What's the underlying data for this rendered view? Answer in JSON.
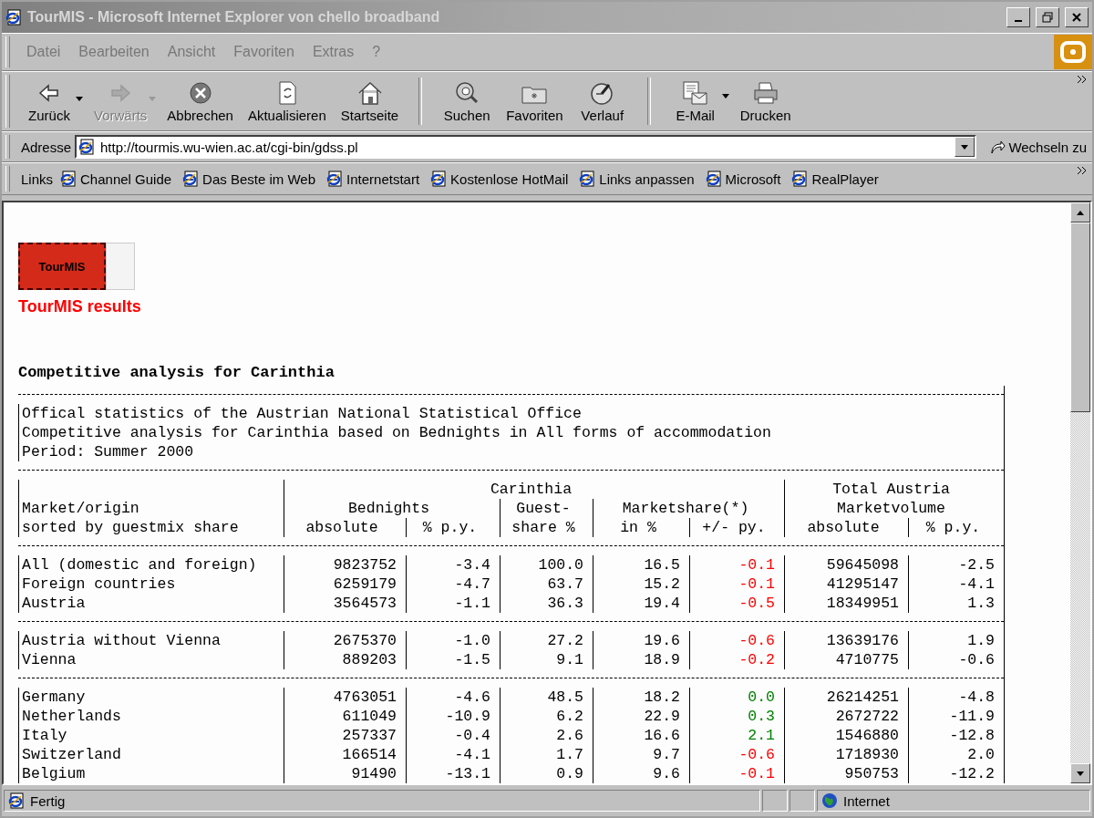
{
  "window": {
    "title": "TourMIS - Microsoft Internet Explorer von chello broadband"
  },
  "menu": [
    "Datei",
    "Bearbeiten",
    "Ansicht",
    "Favoriten",
    "Extras",
    "?"
  ],
  "toolbar": [
    {
      "label": "Zurück",
      "kind": "back",
      "disabled": false,
      "dropdown": true,
      "separator_before": false
    },
    {
      "label": "Vorwärts",
      "kind": "forward",
      "disabled": true,
      "dropdown": true,
      "separator_before": false
    },
    {
      "label": "Abbrechen",
      "kind": "stop",
      "disabled": false,
      "dropdown": false,
      "separator_before": false
    },
    {
      "label": "Aktualisieren",
      "kind": "refresh",
      "disabled": false,
      "dropdown": false,
      "separator_before": false
    },
    {
      "label": "Startseite",
      "kind": "home",
      "disabled": false,
      "dropdown": false,
      "separator_before": false
    },
    {
      "label": "Suchen",
      "kind": "search",
      "disabled": false,
      "dropdown": false,
      "separator_before": true
    },
    {
      "label": "Favoriten",
      "kind": "favorites",
      "disabled": false,
      "dropdown": false,
      "separator_before": false
    },
    {
      "label": "Verlauf",
      "kind": "history",
      "disabled": false,
      "dropdown": false,
      "separator_before": false
    },
    {
      "label": "E-Mail",
      "kind": "mail",
      "disabled": false,
      "dropdown": true,
      "separator_before": true
    },
    {
      "label": "Drucken",
      "kind": "print",
      "disabled": false,
      "dropdown": false,
      "separator_before": false
    }
  ],
  "address": {
    "label": "Adresse",
    "url": "http://tourmis.wu-wien.ac.at/cgi-bin/gdss.pl",
    "go": "Wechseln zu"
  },
  "links": {
    "label": "Links",
    "items": [
      "Channel Guide",
      "Das Beste im Web",
      "Internetstart",
      "Kostenlose HotMail",
      "Links anpassen",
      "Microsoft",
      "RealPlayer"
    ]
  },
  "page": {
    "logo_text": "TourMIS",
    "results_heading": "TourMIS results",
    "title": "Competitive analysis for Carinthia",
    "notes": [
      "Offical statistics of the Austrian National Statistical Office",
      "Competitive analysis for Carinthia based on Bednights in All forms of accommodation",
      "Period: Summer 2000"
    ],
    "header": {
      "region": "Carinthia",
      "total": "Total Austria",
      "market": "Market/origin",
      "sorted": "sorted by guestmix share",
      "bednights": "Bednights",
      "guest": "Guest-",
      "marketshare": "Marketshare(*)",
      "marketvolume": "Marketvolume",
      "columns": [
        "absolute",
        "% p.y.",
        "share %",
        "in %",
        "+/- py.",
        "absolute",
        "% p.y."
      ]
    },
    "groups": [
      [
        {
          "market": "All (domestic and foreign)",
          "bednights": "9823752",
          "bednights_py": "-3.4",
          "share": "100.0",
          "ms": "16.5",
          "ms_change": "-0.1",
          "color": "#ff0000",
          "volume": "59645098",
          "volume_py": "-2.5"
        },
        {
          "market": "Foreign countries",
          "bednights": "6259179",
          "bednights_py": "-4.7",
          "share": "63.7",
          "ms": "15.2",
          "ms_change": "-0.1",
          "color": "#ff0000",
          "volume": "41295147",
          "volume_py": "-4.1"
        },
        {
          "market": "Austria",
          "bednights": "3564573",
          "bednights_py": "-1.1",
          "share": "36.3",
          "ms": "19.4",
          "ms_change": "-0.5",
          "color": "#ff0000",
          "volume": "18349951",
          "volume_py": "1.3"
        }
      ],
      [
        {
          "market": "Austria without Vienna",
          "bednights": "2675370",
          "bednights_py": "-1.0",
          "share": "27.2",
          "ms": "19.6",
          "ms_change": "-0.6",
          "color": "#ff0000",
          "volume": "13639176",
          "volume_py": "1.9"
        },
        {
          "market": "Vienna",
          "bednights": "889203",
          "bednights_py": "-1.5",
          "share": "9.1",
          "ms": "18.9",
          "ms_change": "-0.2",
          "color": "#ff0000",
          "volume": "4710775",
          "volume_py": "-0.6"
        }
      ],
      [
        {
          "market": "Germany",
          "bednights": "4763051",
          "bednights_py": "-4.6",
          "share": "48.5",
          "ms": "18.2",
          "ms_change": "0.0",
          "color": "#008000",
          "volume": "26214251",
          "volume_py": "-4.8"
        },
        {
          "market": "Netherlands",
          "bednights": "611049",
          "bednights_py": "-10.9",
          "share": "6.2",
          "ms": "22.9",
          "ms_change": "0.3",
          "color": "#008000",
          "volume": "2672722",
          "volume_py": "-11.9"
        },
        {
          "market": "Italy",
          "bednights": "257337",
          "bednights_py": "-0.4",
          "share": "2.6",
          "ms": "16.6",
          "ms_change": "2.1",
          "color": "#008000",
          "volume": "1546880",
          "volume_py": "-12.8"
        },
        {
          "market": "Switzerland",
          "bednights": "166514",
          "bednights_py": "-4.1",
          "share": "1.7",
          "ms": "9.7",
          "ms_change": "-0.6",
          "color": "#ff0000",
          "volume": "1718930",
          "volume_py": "2.0"
        },
        {
          "market": "Belgium",
          "bednights": "91490",
          "bednights_py": "-13.1",
          "share": "0.9",
          "ms": "9.6",
          "ms_change": "-0.1",
          "color": "#ff0000",
          "volume": "950753",
          "volume_py": "-12.2"
        }
      ]
    ]
  },
  "status_bar": {
    "text": "Fertig",
    "zone": "Internet"
  }
}
